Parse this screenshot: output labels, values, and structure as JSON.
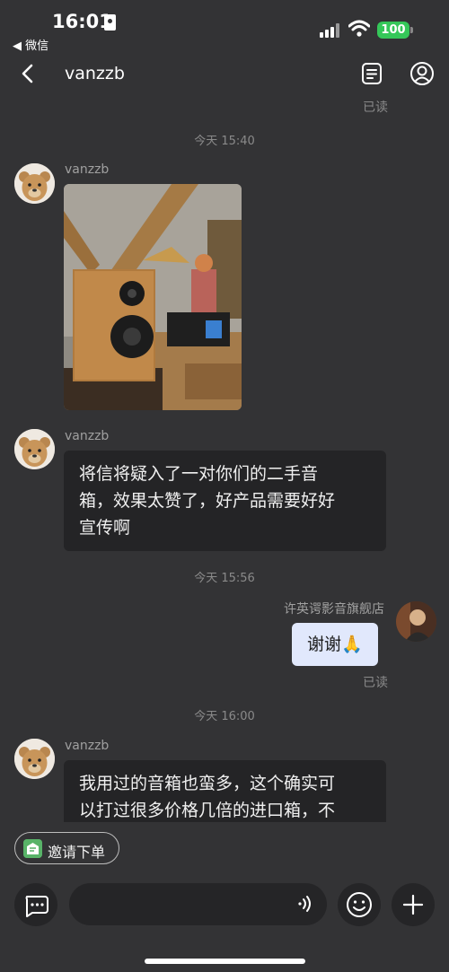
{
  "status_bar": {
    "time": "16:01",
    "back_app": "◀ 微信",
    "battery": "100"
  },
  "nav": {
    "title": "vanzzb"
  },
  "chat": {
    "top_read_status": "已读",
    "messages": [
      {
        "type": "timestamp",
        "text": "今天 15:40"
      },
      {
        "type": "incoming-image",
        "sender": "vanzzb"
      },
      {
        "type": "incoming-text",
        "sender": "vanzzb",
        "lines": [
          "将信将疑入了一对你们的二手音",
          "箱，效果太赞了，好产品需要好好",
          "宣传啊"
        ]
      },
      {
        "type": "timestamp",
        "text": "今天 15:56"
      },
      {
        "type": "outgoing-text",
        "sender": "许英谔影音旗舰店",
        "text": "谢谢🙏",
        "read_status": "已读"
      },
      {
        "type": "timestamp",
        "text": "今天 16:00"
      },
      {
        "type": "incoming-text",
        "sender": "vanzzb",
        "lines": [
          "我用过的音箱也蛮多，这个确实可",
          "以打过很多价格几倍的进口箱，不"
        ]
      }
    ]
  },
  "invite_button": {
    "label": "邀请下单"
  },
  "input_bar": {
    "left_icon": "chat-bubble-icon",
    "voice_icon": "voice-wave-icon",
    "emoji_icon": "smiley-icon",
    "plus_icon": "plus-icon"
  },
  "colors": {
    "background": "#333335",
    "incoming_bubble": "#242426",
    "outgoing_bubble": "#e1e8fc",
    "accent_green": "#58b368",
    "battery_green": "#35c759"
  }
}
